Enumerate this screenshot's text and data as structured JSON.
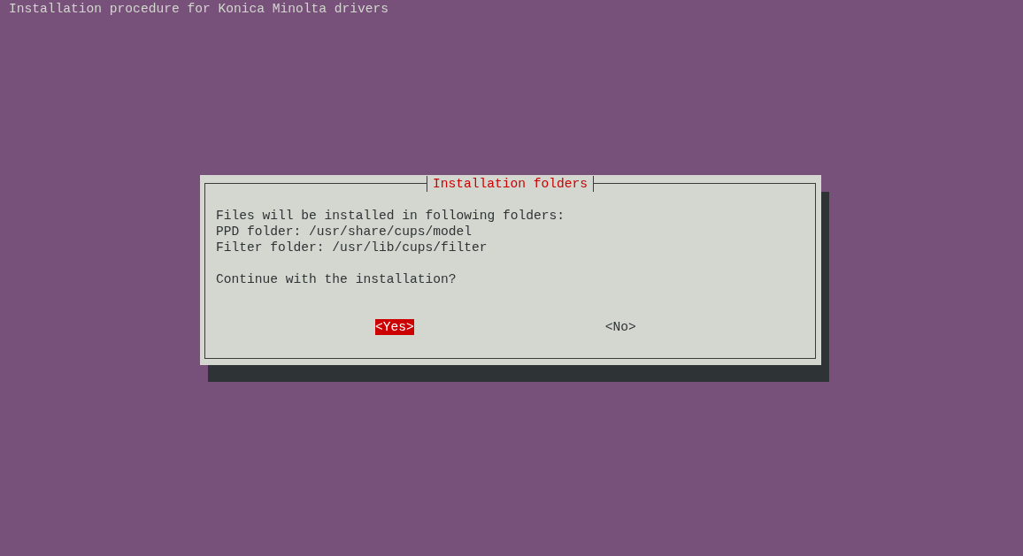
{
  "terminal_title": "Installation procedure for Konica Minolta drivers",
  "dialog": {
    "title": "Installation folders",
    "lines": [
      "Files will be installed in following folders:",
      "PPD folder: /usr/share/cups/model",
      "Filter folder: /usr/lib/cups/filter"
    ],
    "question": "Continue with the installation?",
    "buttons": [
      {
        "label": "<Yes>",
        "selected": true
      },
      {
        "label": "<No>",
        "selected": false
      }
    ]
  }
}
